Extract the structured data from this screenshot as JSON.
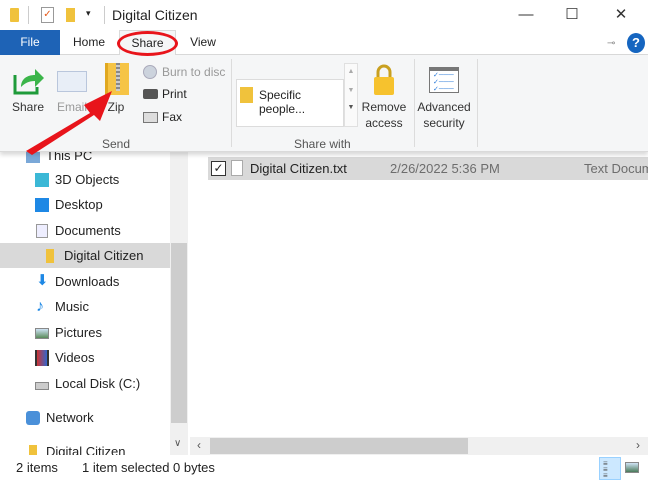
{
  "window": {
    "title": "Digital Citizen",
    "minimize": "—",
    "maximize": "☐",
    "close": "✕"
  },
  "tabs": [
    {
      "label": "File"
    },
    {
      "label": "Home"
    },
    {
      "label": "Share"
    },
    {
      "label": "View"
    }
  ],
  "ribbon": {
    "send": {
      "group": "Send",
      "share": "Share",
      "email": "Email",
      "zip": "Zip",
      "burn": "Burn to disc",
      "print": "Print",
      "fax": "Fax"
    },
    "share_with": {
      "group": "Share with",
      "gallery_item": "Specific people...",
      "remove_access": [
        "Remove",
        "access"
      ]
    },
    "advanced_security": [
      "Advanced",
      "security"
    ]
  },
  "nav": {
    "items": [
      {
        "label": "This PC"
      },
      {
        "label": "3D Objects"
      },
      {
        "label": "Desktop"
      },
      {
        "label": "Documents"
      },
      {
        "label": "Digital Citizen"
      },
      {
        "label": "Downloads"
      },
      {
        "label": "Music"
      },
      {
        "label": "Pictures"
      },
      {
        "label": "Videos"
      },
      {
        "label": "Local Disk (C:)"
      },
      {
        "label": "Network"
      },
      {
        "label": "Digital Citizen"
      }
    ]
  },
  "files": [
    {
      "name": "Digital Citizen.txt",
      "date": "2/26/2022 5:36 PM",
      "type": "Text Document"
    }
  ],
  "status": {
    "count": "2 items",
    "selected": "1 item selected",
    "size": "0 bytes"
  },
  "colors": {
    "accent": "#1e63b6",
    "annotation": "#e8141b",
    "selection": "#d9d9d9"
  }
}
